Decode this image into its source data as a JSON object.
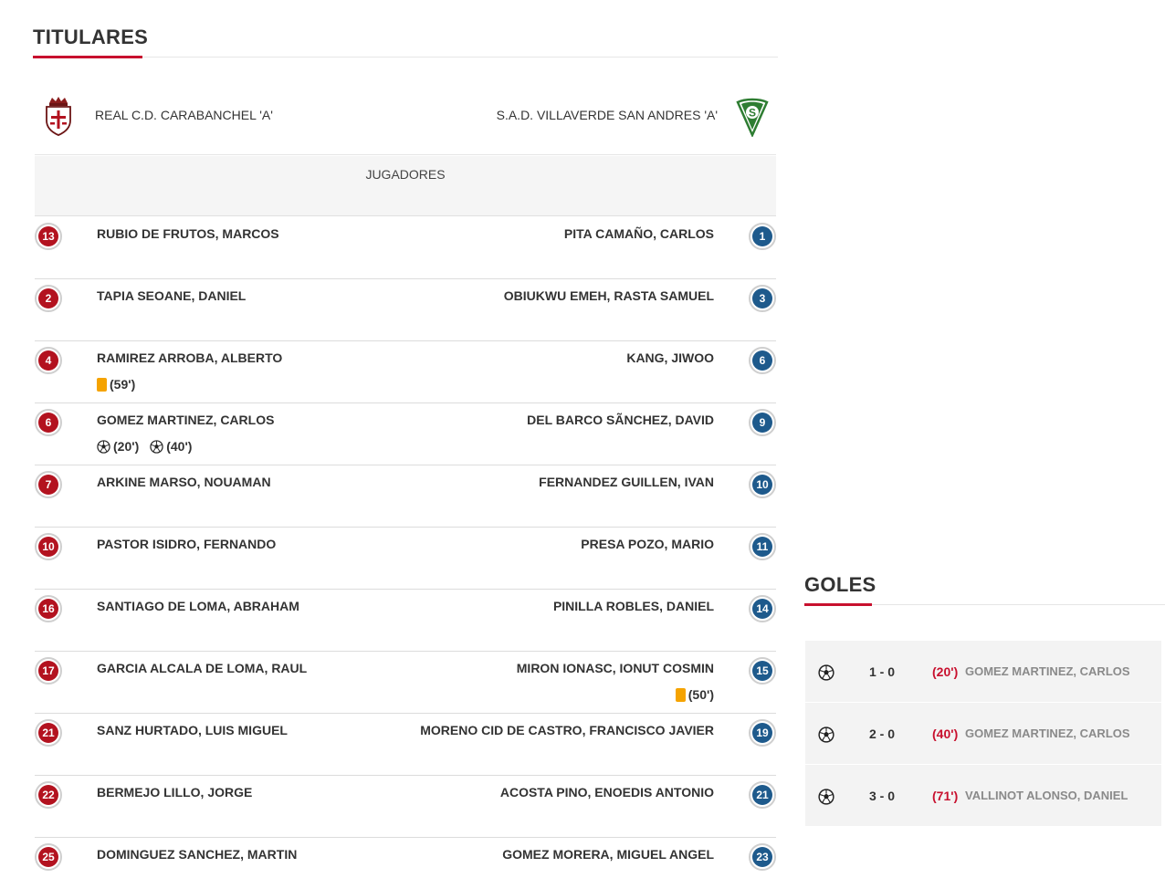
{
  "titulares": {
    "title": "TITULARES",
    "home_team": "REAL C.D. CARABANCHEL 'A'",
    "away_team": "S.A.D. VILLAVERDE SAN ANDRES 'A'",
    "players_header": "JUGADORES",
    "rows": [
      {
        "home": {
          "num": "13",
          "name": "RUBIO DE FRUTOS, MARCOS"
        },
        "away": {
          "num": "1",
          "name": "PITA CAMAÑO, CARLOS"
        }
      },
      {
        "home": {
          "num": "2",
          "name": "TAPIA SEOANE, DANIEL"
        },
        "away": {
          "num": "3",
          "name": "OBIUKWU EMEH, RASTA SAMUEL"
        }
      },
      {
        "home": {
          "num": "4",
          "name": "RAMIREZ ARROBA, ALBERTO",
          "events": [
            {
              "type": "yellow-card",
              "minute": "(59')"
            }
          ]
        },
        "away": {
          "num": "6",
          "name": "KANG, JIWOO"
        }
      },
      {
        "home": {
          "num": "6",
          "name": "GOMEZ MARTINEZ, CARLOS",
          "events": [
            {
              "type": "goal",
              "minute": "(20')"
            },
            {
              "type": "goal",
              "minute": "(40')"
            }
          ]
        },
        "away": {
          "num": "9",
          "name": "DEL BARCO SÃNCHEZ, DAVID"
        }
      },
      {
        "home": {
          "num": "7",
          "name": "ARKINE MARSO, NOUAMAN"
        },
        "away": {
          "num": "10",
          "name": "FERNANDEZ GUILLEN, IVAN"
        }
      },
      {
        "home": {
          "num": "10",
          "name": "PASTOR ISIDRO, FERNANDO"
        },
        "away": {
          "num": "11",
          "name": "PRESA POZO, MARIO"
        }
      },
      {
        "home": {
          "num": "16",
          "name": "SANTIAGO DE LOMA, ABRAHAM"
        },
        "away": {
          "num": "14",
          "name": "PINILLA ROBLES, DANIEL"
        }
      },
      {
        "home": {
          "num": "17",
          "name": "GARCIA ALCALA DE LOMA, RAUL"
        },
        "away": {
          "num": "15",
          "name": "MIRON IONASC, IONUT COSMIN",
          "events": [
            {
              "type": "yellow-card",
              "minute": "(50')"
            }
          ]
        }
      },
      {
        "home": {
          "num": "21",
          "name": "SANZ HURTADO, LUIS MIGUEL"
        },
        "away": {
          "num": "19",
          "name": "MORENO CID DE CASTRO, FRANCISCO JAVIER"
        }
      },
      {
        "home": {
          "num": "22",
          "name": "BERMEJO LILLO, JORGE"
        },
        "away": {
          "num": "21",
          "name": "ACOSTA PINO, ENOEDIS ANTONIO"
        }
      },
      {
        "home": {
          "num": "25",
          "name": "DOMINGUEZ SANCHEZ, MARTIN"
        },
        "away": {
          "num": "23",
          "name": "GOMEZ MORERA, MIGUEL ANGEL"
        }
      }
    ]
  },
  "goles": {
    "title": "GOLES",
    "items": [
      {
        "score": "1 - 0",
        "minute": "(20')",
        "player": "GOMEZ MARTINEZ, CARLOS"
      },
      {
        "score": "2 - 0",
        "minute": "(40')",
        "player": "GOMEZ MARTINEZ, CARLOS"
      },
      {
        "score": "3 - 0",
        "minute": "(71')",
        "player": "VALLINOT ALONSO, DANIEL"
      }
    ]
  },
  "colors": {
    "accent": "#c8102e",
    "home_number": "#b3121f",
    "away_number": "#1e5a8c",
    "yellow_card": "#f5a300"
  },
  "icons": {
    "home_crest": "shield-crown-cross-crest-icon",
    "away_crest": "green-triangle-s-crest-icon",
    "goal": "soccer-ball-icon",
    "booking": "yellow-card-icon"
  }
}
